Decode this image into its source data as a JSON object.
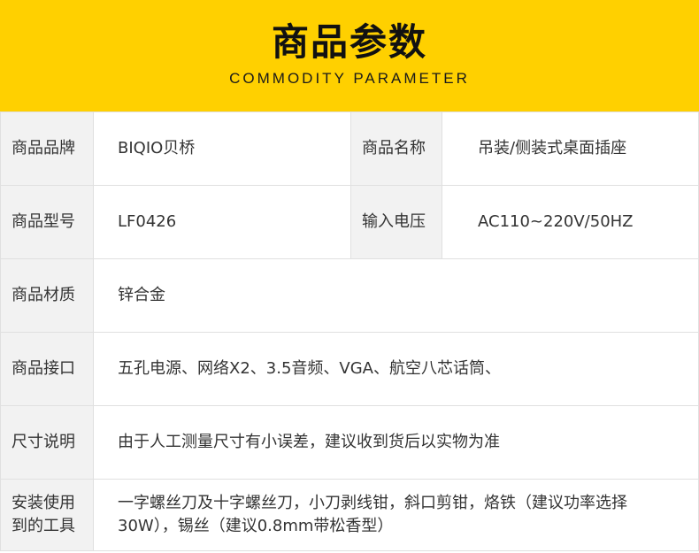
{
  "header": {
    "title": "商品参数",
    "subtitle": "COMMODITY PARAMETER"
  },
  "colors": {
    "banner": "#ffd000",
    "label_bg": "#f2f2f2",
    "border": "#e0e0e0"
  },
  "rows": [
    {
      "label": "商品品牌",
      "value": "BIQIO贝桥",
      "label2": "商品名称",
      "value2": "吊装/侧装式桌面插座"
    },
    {
      "label": "商品型号",
      "value": "LF0426",
      "label2": "输入电压",
      "value2": "AC110~220V/50HZ"
    },
    {
      "label": "商品材质",
      "value": "锌合金"
    },
    {
      "label": "商品接口",
      "value": "五孔电源、网络X2、3.5音频、VGA、航空八芯话筒、"
    },
    {
      "label": "尺寸说明",
      "value": "由于人工测量尺寸有小误差，建议收到货后以实物为准"
    },
    {
      "label_lines": [
        "安装使用",
        "到的工具"
      ],
      "value_lines": [
        "一字螺丝刀及十字螺丝刀，小刀剥线钳，斜口剪钳，烙铁（建议功率选择",
        "30W），锡丝（建议0.8mm带松香型）"
      ]
    }
  ]
}
